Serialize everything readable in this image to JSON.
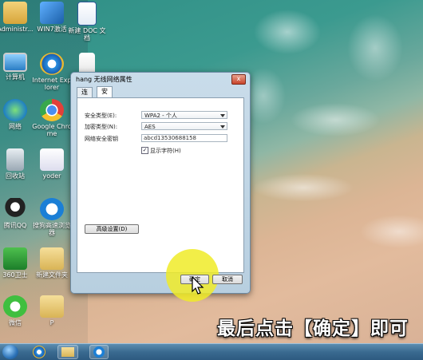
{
  "desktop": {
    "icons": [
      {
        "label": "Administr...",
        "icon": "user-folder-icon"
      },
      {
        "label": "WIN7激活",
        "icon": "activation-icon"
      },
      {
        "label": "新建 DOC 文档",
        "icon": "word-doc-icon"
      },
      {
        "label": "计算机",
        "icon": "computer-icon"
      },
      {
        "label": "Internet Explorer",
        "icon": "ie-icon"
      },
      {
        "label": "",
        "icon": "file-icon"
      },
      {
        "label": "网络",
        "icon": "network-icon"
      },
      {
        "label": "Google Chrome",
        "icon": "chrome-icon"
      },
      {
        "label": "回收站",
        "icon": "recycle-bin-icon"
      },
      {
        "label": "yoder",
        "icon": "yoder-icon"
      },
      {
        "label": "腾讯QQ",
        "icon": "qq-icon"
      },
      {
        "label": "搜狗高速浏览器",
        "icon": "sogou-browser-icon"
      },
      {
        "label": "360卫士",
        "icon": "360-icon"
      },
      {
        "label": "新建文件夹",
        "icon": "folder-icon"
      },
      {
        "label": "微信",
        "icon": "wechat-icon"
      },
      {
        "label": "P",
        "icon": "folder-icon"
      }
    ]
  },
  "dialog": {
    "title": "hang 无线网络属性",
    "close_label": "x",
    "tabs": [
      {
        "label": "连接",
        "active": false
      },
      {
        "label": "安全",
        "active": true
      }
    ],
    "security_type_label": "安全类型(E):",
    "security_type_value": "WPA2 - 个人",
    "encryption_type_label": "加密类型(N):",
    "encryption_type_value": "AES",
    "network_key_label": "网络安全密钥",
    "network_key_value": "abcd13530688158",
    "show_chars_label": "显示字符(H)",
    "show_chars_checked": true,
    "advanced_button": "高级设置(D)",
    "ok_button": "确定",
    "cancel_button": "取消"
  },
  "caption": "最后点击【确定】即可",
  "taskbar": {
    "items": [
      "start-orb-icon",
      "ie-icon",
      "explorer-icon",
      "sogou-icon"
    ]
  },
  "colors": {
    "highlight": "#f0eb28",
    "taskbar": "#3a6a90",
    "dialog_frame": "#c9dcea"
  }
}
